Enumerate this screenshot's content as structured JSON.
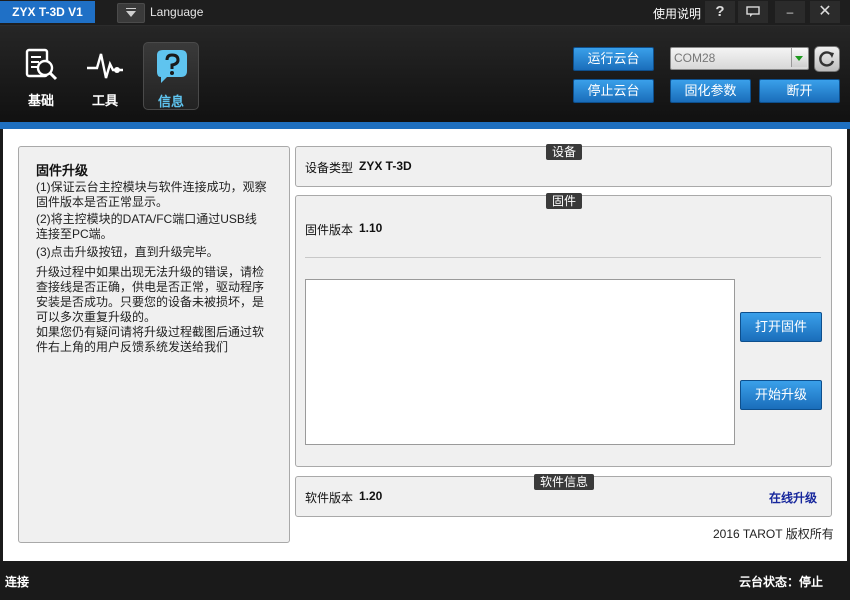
{
  "titlebar": {
    "app_name": "ZYX T-3D V1",
    "language_label": "Language",
    "help_label": "使用说明",
    "help_icon": "?",
    "minimize_icon": "–",
    "close_icon": "✕"
  },
  "nav": [
    {
      "label": "基础",
      "icon": "search-doc-icon",
      "active": false
    },
    {
      "label": "工具",
      "icon": "waveform-icon",
      "active": false
    },
    {
      "label": "信息",
      "icon": "help-bubble-icon",
      "active": true
    }
  ],
  "controls": {
    "run_gimbal": "运行云台",
    "stop_gimbal": "停止云台",
    "com_port": "COM28",
    "fix_params": "固化参数",
    "disconnect": "断开"
  },
  "left_panel": {
    "title": "固件升级",
    "steps": [
      "(1)保证云台主控模块与软件连接成功，观察固件版本是否正常显示。",
      "(2)将主控模块的DATA/FC端口通过USB线连接至PC端。",
      "(3)点击升级按钮，直到升级完毕。"
    ],
    "note1": "升级过程中如果出现无法升级的错误，请检查接线是否正确，供电是否正常，驱动程序安装是否成功。只要您的设备未被损坏，是可以多次重复升级的。",
    "note2": "如果您仍有疑问请将升级过程截图后通过软件右上角的用户反馈系统发送给我们"
  },
  "device": {
    "section": "设备",
    "type_label": "设备类型",
    "type_value": "ZYX T-3D"
  },
  "firmware": {
    "section": "固件",
    "version_label": "固件版本",
    "version_value": "1.10",
    "open_button": "打开固件",
    "upgrade_button": "开始升级"
  },
  "software": {
    "section": "软件信息",
    "version_label": "软件版本",
    "version_value": "1.20",
    "online_upgrade": "在线升级"
  },
  "copyright": "2016 TAROT 版权所有",
  "statusbar": {
    "connection": "连接",
    "gimbal_status": "云台状态：停止"
  },
  "colors": {
    "accent_blue": "#1f70c6",
    "active_nav_text": "#5fc4ef",
    "link_blue": "#17279c"
  }
}
